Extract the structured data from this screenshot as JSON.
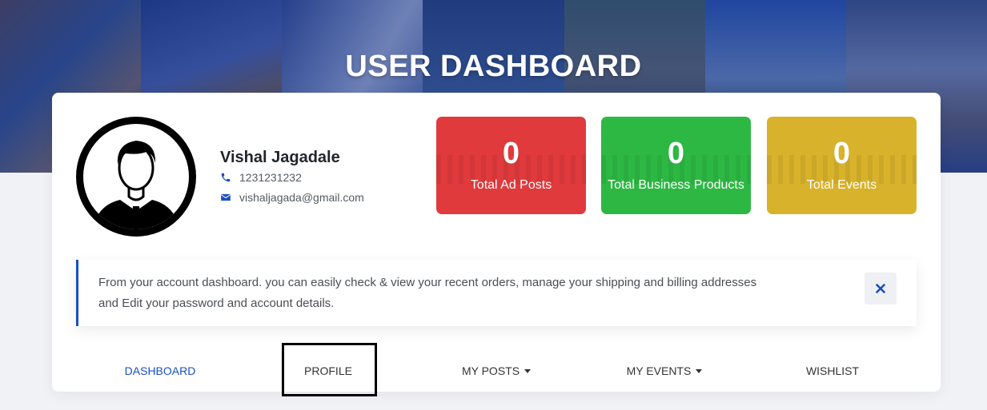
{
  "banner": {
    "title": "USER DASHBOARD"
  },
  "profile": {
    "name": "Vishal Jagadale",
    "phone": "1231231232",
    "email": "vishaljagada@gmail.com"
  },
  "stats": [
    {
      "value": "0",
      "label": "Total Ad Posts",
      "color": "#e03a3c"
    },
    {
      "value": "0",
      "label": "Total Business Products",
      "color": "#2db843"
    },
    {
      "value": "0",
      "label": "Total Events",
      "color": "#d8b22a"
    }
  ],
  "notice": {
    "text": "From your account dashboard. you can easily check & view your recent orders, manage your shipping and billing addresses and Edit your password and account details."
  },
  "nav": [
    {
      "label": "DASHBOARD"
    },
    {
      "label": "PROFILE"
    },
    {
      "label": "MY POSTS"
    },
    {
      "label": "MY EVENTS"
    },
    {
      "label": "WISHLIST"
    }
  ],
  "colors": {
    "accent": "#1a4fc0",
    "banner_overlay": "#18348c"
  }
}
